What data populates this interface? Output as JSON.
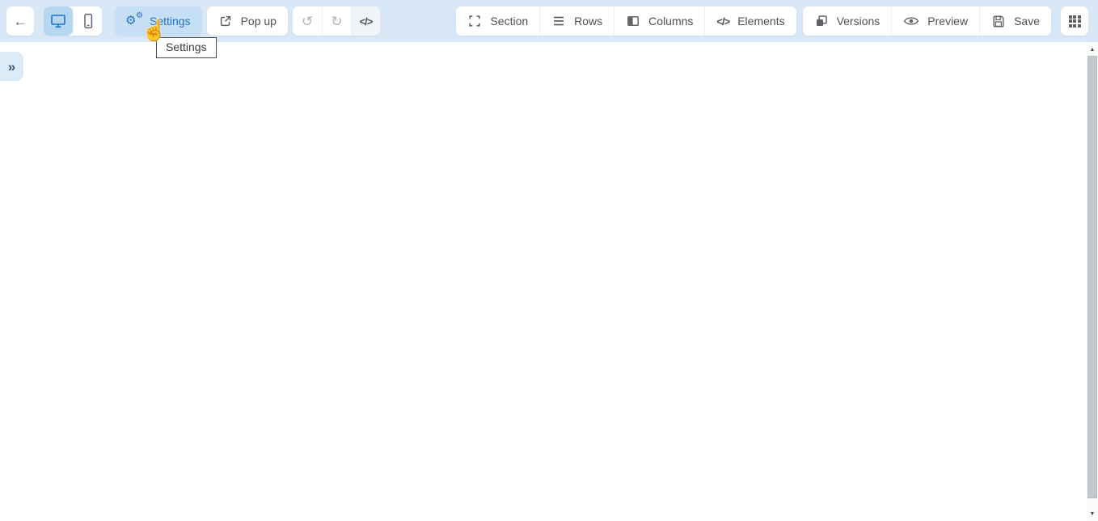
{
  "colors": {
    "toolbar_bg": "#d8e8f6",
    "accent_blue": "#2273c3",
    "selected_button_bg": "#c6dff4",
    "device_active_bg": "#b5d7f0",
    "button_text": "#4d5156"
  },
  "toolbar": {
    "settings_label": "Settings",
    "popup_label": "Pop up",
    "builder": {
      "section": "Section",
      "rows": "Rows",
      "columns": "Columns",
      "elements": "Elements"
    },
    "actions": {
      "versions": "Versions",
      "preview": "Preview",
      "save": "Save"
    }
  },
  "tooltip": {
    "text": "Settings"
  },
  "icons": {
    "back": "←",
    "gear": "⚙",
    "undo": "↺",
    "redo": "↻",
    "code": "</>",
    "elements_code": "</>",
    "panel_expand": "»",
    "pointer_hand": "☝",
    "scroll_up": "▲",
    "scroll_down": "▼"
  }
}
